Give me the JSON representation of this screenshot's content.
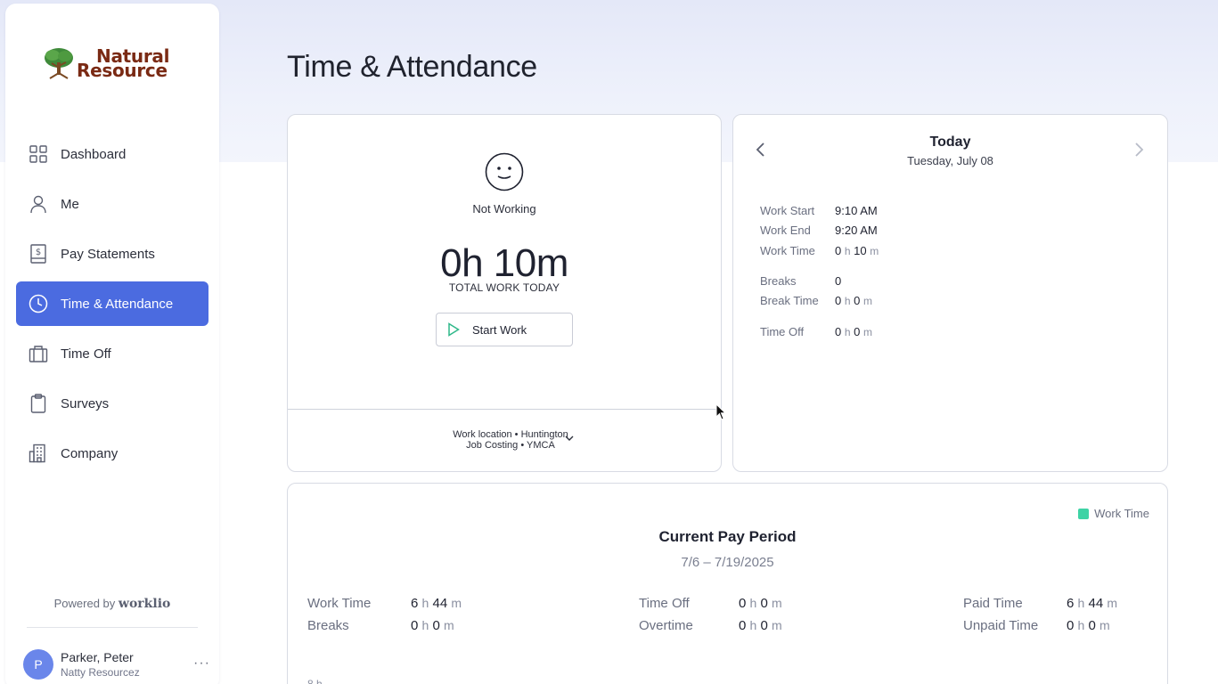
{
  "brand": {
    "line1": "Natural",
    "line2": "Resource",
    "color": "#7a2a14"
  },
  "sidebar": {
    "items": [
      {
        "label": "Dashboard",
        "icon": "grid-icon"
      },
      {
        "label": "Me",
        "icon": "person-icon"
      },
      {
        "label": "Pay Statements",
        "icon": "pay-statement-icon"
      },
      {
        "label": "Time & Attendance",
        "icon": "clock-icon",
        "active": true
      },
      {
        "label": "Time Off",
        "icon": "briefcase-icon"
      },
      {
        "label": "Surveys",
        "icon": "clipboard-icon"
      },
      {
        "label": "Company",
        "icon": "building-icon"
      }
    ],
    "powered_by_prefix": "Powered by",
    "powered_by_brand": "worklio",
    "user": {
      "initial": "P",
      "name": "Parker, Peter",
      "org": "Natty Resourcez",
      "more": "···"
    },
    "active_color": "#4b6be0"
  },
  "page": {
    "title": "Time & Attendance"
  },
  "status_card": {
    "status": "Not Working",
    "total_time": "0h 10m",
    "total_label": "TOTAL WORK TODAY",
    "start_button": "Start Work",
    "work_location": "Work location • Huntington",
    "job_costing": "Job Costing • YMCA"
  },
  "today_card": {
    "title": "Today",
    "date": "Tuesday, July 08",
    "rows": {
      "work_start": {
        "label": "Work Start",
        "value": "9:10 AM"
      },
      "work_end": {
        "label": "Work End",
        "value": "9:20 AM"
      },
      "work_time": {
        "label": "Work Time",
        "h": "0",
        "m": "10"
      },
      "breaks": {
        "label": "Breaks",
        "value": "0"
      },
      "break_time": {
        "label": "Break Time",
        "h": "0",
        "m": "0"
      },
      "time_off": {
        "label": "Time Off",
        "h": "0",
        "m": "0"
      }
    }
  },
  "units": {
    "h": "h",
    "m": "m"
  },
  "pay_period": {
    "legend": "Work Time",
    "legend_color": "#3ed3a5",
    "title": "Current Pay Period",
    "range": "7/6 – 7/19/2025",
    "stats": {
      "work_time": {
        "label": "Work Time",
        "h": "6",
        "m": "44"
      },
      "breaks": {
        "label": "Breaks",
        "h": "0",
        "m": "0"
      },
      "time_off": {
        "label": "Time Off",
        "h": "0",
        "m": "0"
      },
      "overtime": {
        "label": "Overtime",
        "h": "0",
        "m": "0"
      },
      "paid_time": {
        "label": "Paid Time",
        "h": "6",
        "m": "44"
      },
      "unpaid_time": {
        "label": "Unpaid Time",
        "h": "0",
        "m": "0"
      }
    },
    "axis_top_label": "8 h"
  }
}
